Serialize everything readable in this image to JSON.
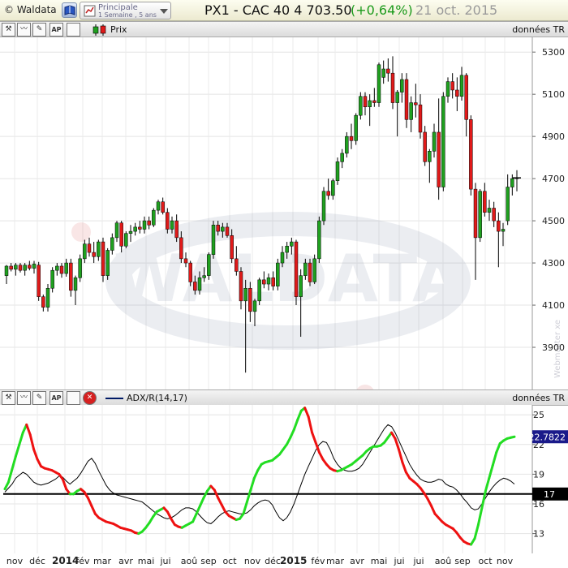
{
  "titlebar": {
    "app_name": "© Waldata",
    "layout_name": "Principale",
    "layout_period": "1 Semaine , 5 ans",
    "instrument": "PX1 - CAC 40  4 703.50",
    "change": "(+0,64%)",
    "date": "21 oct. 2015",
    "book_icon": "book-icon"
  },
  "price_toolbar": {
    "series_label": "Prix",
    "data_label": "données TR",
    "ap_label": "AP"
  },
  "adx_toolbar": {
    "series_label": "ADX/R(14,17)",
    "data_label": "données TR",
    "ap_label": "AP"
  },
  "watermark": {
    "text": "WALDATA",
    "side_text": "Webmaster xe"
  },
  "colors": {
    "up": "#1fa01f",
    "down": "#e01a1a",
    "adx_up": "#22dd22",
    "adx_down": "#ee1111",
    "adxr": "#000000"
  },
  "chart_data": [
    {
      "type": "candlestick",
      "title": "PX1 - CAC 40",
      "interval": "weekly",
      "ylim": [
        3700,
        5370
      ],
      "yticks": [
        3900,
        4100,
        4300,
        4500,
        4700,
        4900,
        5100,
        5300
      ],
      "grid": true,
      "x_month_labels": [
        "nov",
        "déc",
        "2014",
        "fév",
        "mar",
        "avr",
        "mai",
        "jui",
        "aoû",
        "sep",
        "oct",
        "nov",
        "déc",
        "2015",
        "fév",
        "mar",
        "avr",
        "mai",
        "jui",
        "jui",
        "aoû",
        "sep",
        "oct",
        "nov"
      ],
      "candles": [
        {
          "o": 4240,
          "h": 4290,
          "l": 4200,
          "c": 4285
        },
        {
          "o": 4285,
          "h": 4300,
          "l": 4260,
          "c": 4270
        },
        {
          "o": 4270,
          "h": 4300,
          "l": 4240,
          "c": 4290
        },
        {
          "o": 4290,
          "h": 4300,
          "l": 4255,
          "c": 4265
        },
        {
          "o": 4265,
          "h": 4300,
          "l": 4240,
          "c": 4290
        },
        {
          "o": 4290,
          "h": 4310,
          "l": 4265,
          "c": 4275
        },
        {
          "o": 4275,
          "h": 4310,
          "l": 4250,
          "c": 4295
        },
        {
          "o": 4290,
          "h": 4305,
          "l": 4120,
          "c": 4140
        },
        {
          "o": 4140,
          "h": 4150,
          "l": 4070,
          "c": 4090
        },
        {
          "o": 4090,
          "h": 4200,
          "l": 4070,
          "c": 4180
        },
        {
          "o": 4180,
          "h": 4280,
          "l": 4160,
          "c": 4265
        },
        {
          "o": 4265,
          "h": 4300,
          "l": 4240,
          "c": 4285
        },
        {
          "o": 4285,
          "h": 4300,
          "l": 4230,
          "c": 4250
        },
        {
          "o": 4250,
          "h": 4320,
          "l": 4235,
          "c": 4300
        },
        {
          "o": 4300,
          "h": 4320,
          "l": 4140,
          "c": 4170
        },
        {
          "o": 4170,
          "h": 4240,
          "l": 4100,
          "c": 4230
        },
        {
          "o": 4230,
          "h": 4340,
          "l": 4210,
          "c": 4320
        },
        {
          "o": 4320,
          "h": 4410,
          "l": 4300,
          "c": 4390
        },
        {
          "o": 4390,
          "h": 4420,
          "l": 4330,
          "c": 4350
        },
        {
          "o": 4350,
          "h": 4400,
          "l": 4300,
          "c": 4330
        },
        {
          "o": 4330,
          "h": 4410,
          "l": 4310,
          "c": 4400
        },
        {
          "o": 4400,
          "h": 4420,
          "l": 4210,
          "c": 4240
        },
        {
          "o": 4240,
          "h": 4370,
          "l": 4220,
          "c": 4360
        },
        {
          "o": 4360,
          "h": 4440,
          "l": 4340,
          "c": 4420
        },
        {
          "o": 4420,
          "h": 4500,
          "l": 4400,
          "c": 4490
        },
        {
          "o": 4490,
          "h": 4500,
          "l": 4350,
          "c": 4380
        },
        {
          "o": 4380,
          "h": 4450,
          "l": 4370,
          "c": 4440
        },
        {
          "o": 4440,
          "h": 4480,
          "l": 4400,
          "c": 4450
        },
        {
          "o": 4450,
          "h": 4490,
          "l": 4430,
          "c": 4470
        },
        {
          "o": 4470,
          "h": 4500,
          "l": 4440,
          "c": 4460
        },
        {
          "o": 4460,
          "h": 4520,
          "l": 4440,
          "c": 4500
        },
        {
          "o": 4500,
          "h": 4520,
          "l": 4460,
          "c": 4480
        },
        {
          "o": 4480,
          "h": 4560,
          "l": 4470,
          "c": 4550
        },
        {
          "o": 4550,
          "h": 4600,
          "l": 4530,
          "c": 4590
        },
        {
          "o": 4590,
          "h": 4610,
          "l": 4530,
          "c": 4540
        },
        {
          "o": 4540,
          "h": 4560,
          "l": 4440,
          "c": 4460
        },
        {
          "o": 4460,
          "h": 4520,
          "l": 4440,
          "c": 4500
        },
        {
          "o": 4500,
          "h": 4530,
          "l": 4400,
          "c": 4420
        },
        {
          "o": 4420,
          "h": 4450,
          "l": 4300,
          "c": 4320
        },
        {
          "o": 4320,
          "h": 4350,
          "l": 4280,
          "c": 4300
        },
        {
          "o": 4300,
          "h": 4310,
          "l": 4190,
          "c": 4210
        },
        {
          "o": 4210,
          "h": 4240,
          "l": 4150,
          "c": 4170
        },
        {
          "o": 4170,
          "h": 4260,
          "l": 4150,
          "c": 4230
        },
        {
          "o": 4230,
          "h": 4280,
          "l": 4210,
          "c": 4240
        },
        {
          "o": 4240,
          "h": 4350,
          "l": 4220,
          "c": 4340
        },
        {
          "o": 4340,
          "h": 4500,
          "l": 4320,
          "c": 4480
        },
        {
          "o": 4480,
          "h": 4500,
          "l": 4430,
          "c": 4450
        },
        {
          "o": 4450,
          "h": 4490,
          "l": 4420,
          "c": 4470
        },
        {
          "o": 4470,
          "h": 4490,
          "l": 4420,
          "c": 4430
        },
        {
          "o": 4430,
          "h": 4460,
          "l": 4300,
          "c": 4320
        },
        {
          "o": 4320,
          "h": 4380,
          "l": 4240,
          "c": 4260
        },
        {
          "o": 4260,
          "h": 4280,
          "l": 4080,
          "c": 4120
        },
        {
          "o": 4120,
          "h": 4220,
          "l": 3780,
          "c": 4180
        },
        {
          "o": 4180,
          "h": 4210,
          "l": 4020,
          "c": 4070
        },
        {
          "o": 4070,
          "h": 4130,
          "l": 4000,
          "c": 4120
        },
        {
          "o": 4120,
          "h": 4230,
          "l": 4100,
          "c": 4220
        },
        {
          "o": 4220,
          "h": 4260,
          "l": 4180,
          "c": 4200
        },
        {
          "o": 4200,
          "h": 4250,
          "l": 4170,
          "c": 4230
        },
        {
          "o": 4230,
          "h": 4260,
          "l": 4170,
          "c": 4190
        },
        {
          "o": 4190,
          "h": 4320,
          "l": 4170,
          "c": 4300
        },
        {
          "o": 4300,
          "h": 4380,
          "l": 4280,
          "c": 4350
        },
        {
          "o": 4350,
          "h": 4400,
          "l": 4320,
          "c": 4380
        },
        {
          "o": 4380,
          "h": 4420,
          "l": 4340,
          "c": 4400
        },
        {
          "o": 4400,
          "h": 4410,
          "l": 4100,
          "c": 4140
        },
        {
          "o": 4140,
          "h": 4270,
          "l": 3950,
          "c": 4240
        },
        {
          "o": 4240,
          "h": 4320,
          "l": 4220,
          "c": 4300
        },
        {
          "o": 4300,
          "h": 4320,
          "l": 4190,
          "c": 4210
        },
        {
          "o": 4210,
          "h": 4340,
          "l": 4200,
          "c": 4320
        },
        {
          "o": 4320,
          "h": 4520,
          "l": 4300,
          "c": 4500
        },
        {
          "o": 4500,
          "h": 4660,
          "l": 4480,
          "c": 4640
        },
        {
          "o": 4640,
          "h": 4700,
          "l": 4600,
          "c": 4620
        },
        {
          "o": 4620,
          "h": 4700,
          "l": 4600,
          "c": 4690
        },
        {
          "o": 4690,
          "h": 4800,
          "l": 4670,
          "c": 4780
        },
        {
          "o": 4780,
          "h": 4840,
          "l": 4750,
          "c": 4820
        },
        {
          "o": 4820,
          "h": 4920,
          "l": 4800,
          "c": 4900
        },
        {
          "o": 4900,
          "h": 4960,
          "l": 4840,
          "c": 4880
        },
        {
          "o": 4880,
          "h": 5010,
          "l": 4860,
          "c": 5000
        },
        {
          "o": 5000,
          "h": 5110,
          "l": 4980,
          "c": 5090
        },
        {
          "o": 5090,
          "h": 5110,
          "l": 5000,
          "c": 5040
        },
        {
          "o": 5040,
          "h": 5100,
          "l": 4950,
          "c": 5070
        },
        {
          "o": 5070,
          "h": 5130,
          "l": 5040,
          "c": 5060
        },
        {
          "o": 5060,
          "h": 5250,
          "l": 5040,
          "c": 5240
        },
        {
          "o": 5180,
          "h": 5260,
          "l": 5150,
          "c": 5220
        },
        {
          "o": 5220,
          "h": 5270,
          "l": 5160,
          "c": 5200
        },
        {
          "o": 5200,
          "h": 5280,
          "l": 5030,
          "c": 5060
        },
        {
          "o": 5060,
          "h": 5120,
          "l": 4900,
          "c": 5110
        },
        {
          "o": 5110,
          "h": 5200,
          "l": 5060,
          "c": 5170
        },
        {
          "o": 5170,
          "h": 5200,
          "l": 4940,
          "c": 4980
        },
        {
          "o": 4980,
          "h": 5090,
          "l": 4920,
          "c": 5060
        },
        {
          "o": 5060,
          "h": 5150,
          "l": 4990,
          "c": 5050
        },
        {
          "o": 5050,
          "h": 5100,
          "l": 4890,
          "c": 4920
        },
        {
          "o": 4920,
          "h": 4950,
          "l": 4760,
          "c": 4780
        },
        {
          "o": 4780,
          "h": 4840,
          "l": 4680,
          "c": 4830
        },
        {
          "o": 4830,
          "h": 4960,
          "l": 4800,
          "c": 4920
        },
        {
          "o": 4920,
          "h": 5080,
          "l": 4600,
          "c": 4660
        },
        {
          "o": 4660,
          "h": 5110,
          "l": 4640,
          "c": 5090
        },
        {
          "o": 5090,
          "h": 5180,
          "l": 5060,
          "c": 5160
        },
        {
          "o": 5160,
          "h": 5200,
          "l": 5080,
          "c": 5120
        },
        {
          "o": 5120,
          "h": 5180,
          "l": 5020,
          "c": 5090
        },
        {
          "o": 5090,
          "h": 5230,
          "l": 5070,
          "c": 5190
        },
        {
          "o": 5190,
          "h": 5200,
          "l": 4900,
          "c": 4980
        },
        {
          "o": 4980,
          "h": 5000,
          "l": 4620,
          "c": 4650
        },
        {
          "o": 4650,
          "h": 4680,
          "l": 4220,
          "c": 4420
        },
        {
          "o": 4420,
          "h": 4650,
          "l": 4400,
          "c": 4640
        },
        {
          "o": 4640,
          "h": 4680,
          "l": 4520,
          "c": 4540
        },
        {
          "o": 4540,
          "h": 4600,
          "l": 4500,
          "c": 4560
        },
        {
          "o": 4560,
          "h": 4590,
          "l": 4470,
          "c": 4500
        },
        {
          "o": 4500,
          "h": 4540,
          "l": 4280,
          "c": 4450
        },
        {
          "o": 4450,
          "h": 4490,
          "l": 4380,
          "c": 4460
        },
        {
          "o": 4500,
          "h": 4720,
          "l": 4480,
          "c": 4660
        },
        {
          "o": 4660,
          "h": 4720,
          "l": 4620,
          "c": 4700
        },
        {
          "o": 4700,
          "h": 4740,
          "l": 4640,
          "c": 4703.5
        }
      ]
    },
    {
      "type": "line",
      "title": "ADX/R(14,17)",
      "ylim": [
        11,
        26
      ],
      "yticks": [
        13,
        16,
        19,
        22,
        25
      ],
      "grid": true,
      "reference_line": 17,
      "last_adx": "22.7822",
      "level_label": "17",
      "series": [
        {
          "name": "ADX",
          "values": [
            17.5,
            18.2,
            19.5,
            20.8,
            22.0,
            23.2,
            24.0,
            23.0,
            21.5,
            20.5,
            19.8,
            19.6,
            19.5,
            19.4,
            19.2,
            19.0,
            18.5,
            17.5,
            17.0,
            17.0,
            17.3,
            17.5,
            17.2,
            16.6,
            15.8,
            15.0,
            14.6,
            14.4,
            14.2,
            14.1,
            14.0,
            13.8,
            13.6,
            13.5,
            13.4,
            13.3,
            13.1,
            13.0,
            13.2,
            13.6,
            14.1,
            14.7,
            15.2,
            15.4,
            15.6,
            15.2,
            14.5,
            13.9,
            13.7,
            13.6,
            13.8,
            14.0,
            14.2,
            15.0,
            15.8,
            16.6,
            17.3,
            17.8,
            17.4,
            16.6,
            15.9,
            15.2,
            14.8,
            14.6,
            14.4,
            14.5,
            15.0,
            16.2,
            17.4,
            18.6,
            19.4,
            20.0,
            20.2,
            20.3,
            20.4,
            20.7,
            21.0,
            21.5,
            22.0,
            22.7,
            23.5,
            24.5,
            25.4,
            25.7,
            24.8,
            23.2,
            22.2,
            21.2,
            20.5,
            20.0,
            19.6,
            19.4,
            19.3,
            19.4,
            19.6,
            19.8,
            20.0,
            20.3,
            20.6,
            20.9,
            21.3,
            21.6,
            21.8,
            21.8,
            21.9,
            22.2,
            22.7,
            23.2,
            22.6,
            21.5,
            20.2,
            19.2,
            18.6,
            18.3,
            18.0,
            17.6,
            17.1,
            16.5,
            15.8,
            15.0,
            14.6,
            14.2,
            13.9,
            13.7,
            13.5,
            13.1,
            12.6,
            12.2,
            12.0,
            11.9,
            12.5,
            13.9,
            15.6,
            17.3,
            18.6,
            19.9,
            21.2,
            22.1,
            22.4,
            22.6,
            22.7,
            22.7822
          ]
        },
        {
          "name": "ADXR",
          "values": [
            17.2,
            17.6,
            18.0,
            18.6,
            18.9,
            19.2,
            19.0,
            18.6,
            18.2,
            18.0,
            17.9,
            18.0,
            18.1,
            18.3,
            18.5,
            18.8,
            18.7,
            18.3,
            18.0,
            18.3,
            18.6,
            19.1,
            19.7,
            20.3,
            20.6,
            20.1,
            19.3,
            18.6,
            17.9,
            17.4,
            17.1,
            16.9,
            16.8,
            16.7,
            16.6,
            16.5,
            16.4,
            16.3,
            16.2,
            15.9,
            15.6,
            15.3,
            15.0,
            14.8,
            14.6,
            14.5,
            14.6,
            14.8,
            15.1,
            15.4,
            15.6,
            15.6,
            15.5,
            15.2,
            14.8,
            14.4,
            14.1,
            14.0,
            14.3,
            14.7,
            15.0,
            15.2,
            15.3,
            15.2,
            15.1,
            15.0,
            15.0,
            15.1,
            15.4,
            15.8,
            16.1,
            16.3,
            16.4,
            16.3,
            15.9,
            15.2,
            14.6,
            14.3,
            14.6,
            15.2,
            16.0,
            17.0,
            18.0,
            19.0,
            19.8,
            20.6,
            21.4,
            22.0,
            22.3,
            22.2,
            21.5,
            20.6,
            20.0,
            19.6,
            19.4,
            19.3,
            19.3,
            19.4,
            19.6,
            20.0,
            20.6,
            21.2,
            21.8,
            22.4,
            23.0,
            23.6,
            24.0,
            23.8,
            23.2,
            22.4,
            21.6,
            20.8,
            20.0,
            19.4,
            18.9,
            18.5,
            18.3,
            18.2,
            18.2,
            18.3,
            18.5,
            18.4,
            18.0,
            17.8,
            17.7,
            17.4,
            17.0,
            16.5,
            16.1,
            15.6,
            15.4,
            15.5,
            16.0,
            16.6,
            17.2,
            17.7,
            18.1,
            18.4,
            18.6,
            18.5,
            18.3,
            18.0
          ]
        }
      ]
    }
  ]
}
